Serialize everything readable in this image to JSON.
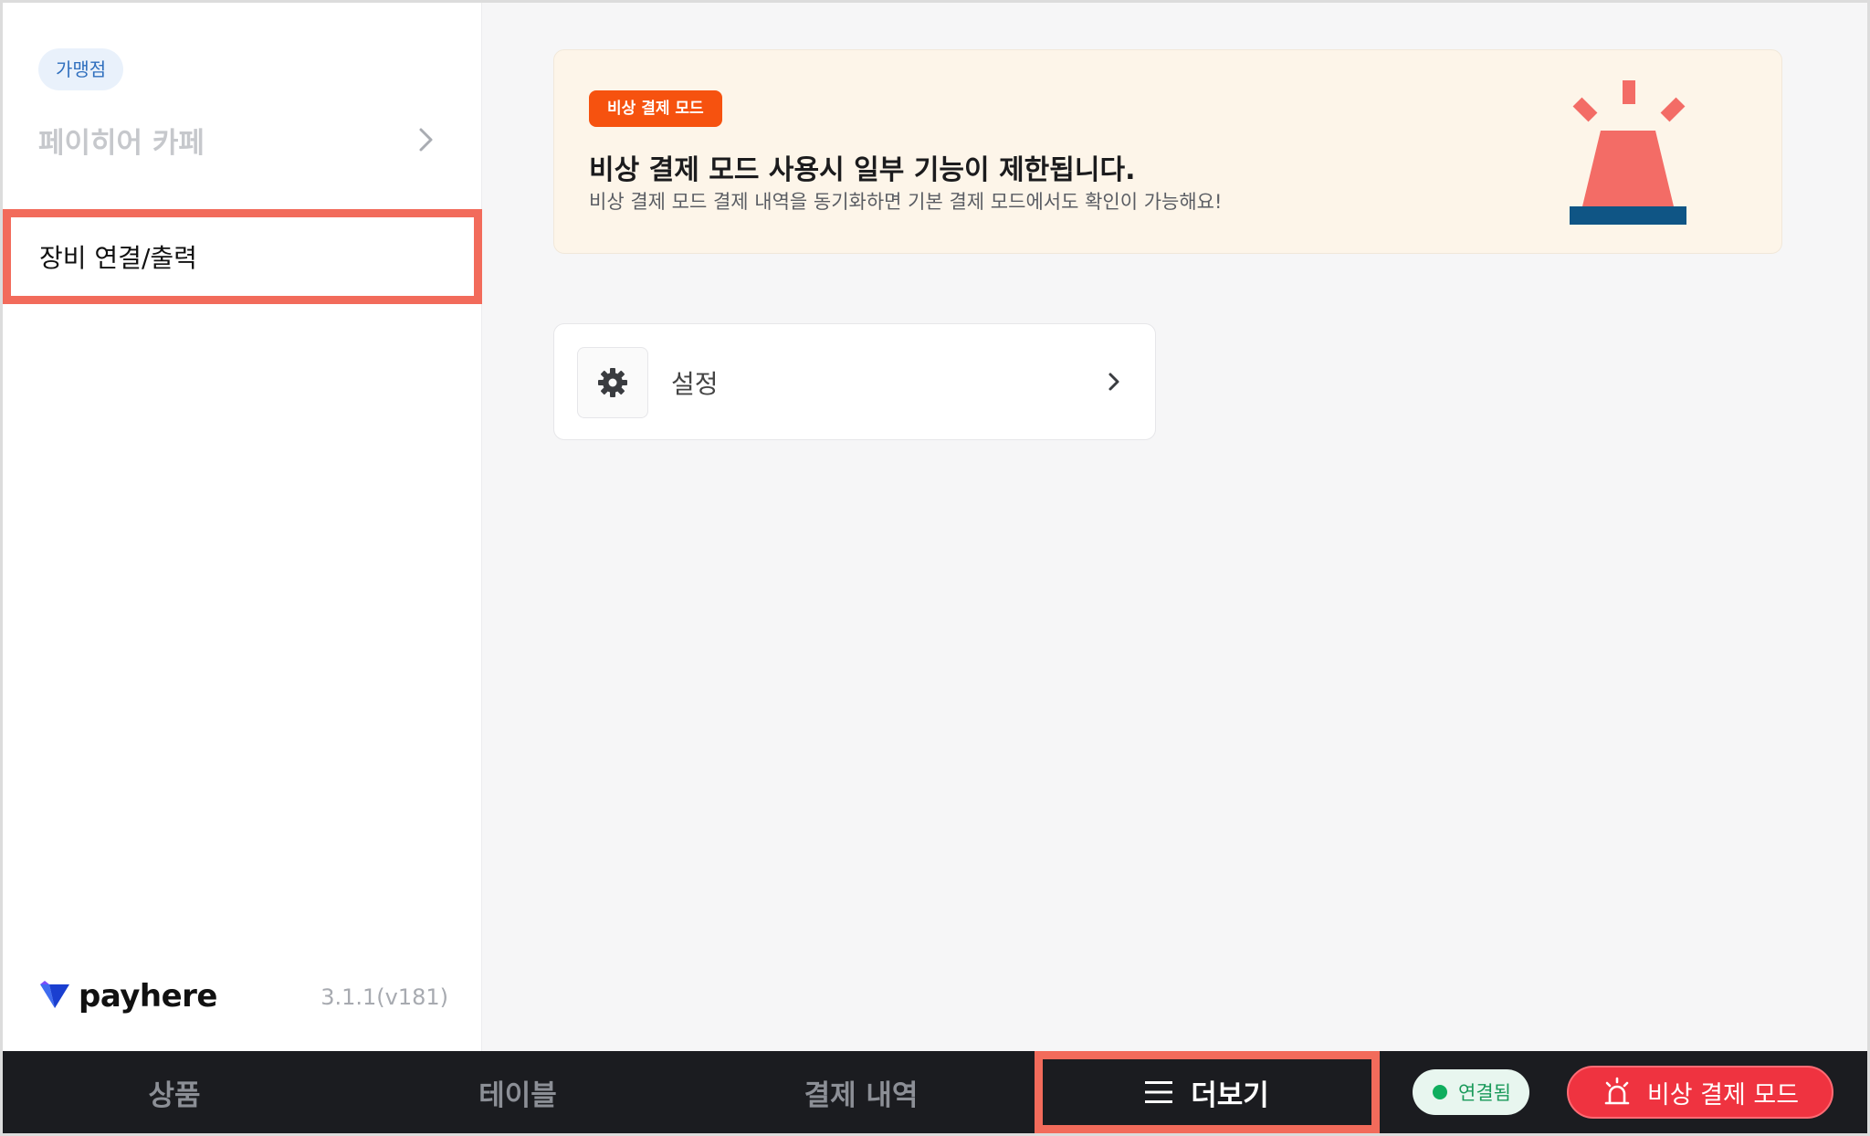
{
  "sidebar": {
    "store_badge": "가맹점",
    "store_name": "페이히어 카페",
    "menu_item": "장비 연결/출력",
    "logo_text": "payhere",
    "version": "3.1.1(v181)"
  },
  "banner": {
    "badge": "비상 결제 모드",
    "title": "비상 결제 모드 사용시 일부 기능이 제한됩니다.",
    "description": "비상 결제 모드 결제 내역을 동기화하면 기본 결제 모드에서도 확인이 가능해요!"
  },
  "settings_card": {
    "label": "설정",
    "icon": "gear-icon"
  },
  "bottom_bar": {
    "tabs": [
      {
        "label": "상품"
      },
      {
        "label": "테이블"
      },
      {
        "label": "결제 내역"
      },
      {
        "label": "더보기",
        "active": true,
        "icon": "menu-icon"
      }
    ],
    "status": "연결됨",
    "emergency_button": "비상 결제 모드"
  },
  "colors": {
    "accent_orange": "#f6520f",
    "highlight_outline": "#f26b5b",
    "emergency_red": "#ef3340",
    "status_green": "#0fae5e",
    "bottom_bar_bg": "#1b1c20"
  }
}
